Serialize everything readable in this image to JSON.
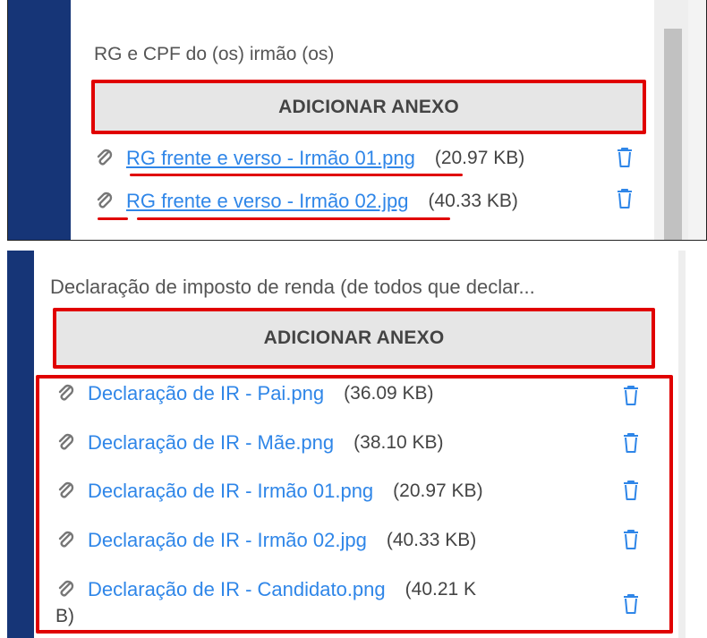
{
  "section1": {
    "label": "RG e CPF do (os) irmão (os)",
    "add_button": "ADICIONAR ANEXO",
    "files": [
      {
        "name": "RG frente e verso - Irmão 01.png",
        "size": "(20.97 KB)"
      },
      {
        "name": "RG frente e verso - Irmão 02.jpg",
        "size": "(40.33 KB)"
      }
    ]
  },
  "section2": {
    "label": "Declaração de imposto de renda (de todos que declar...",
    "add_button": "ADICIONAR ANEXO",
    "files": [
      {
        "name": "Declaração de IR - Pai.png",
        "size": "(36.09 KB)"
      },
      {
        "name": "Declaração de IR - Mãe.png",
        "size": "(38.10 KB)"
      },
      {
        "name": "Declaração de IR - Irmão 01.png",
        "size": "(20.97 KB)"
      },
      {
        "name": "Declaração de IR - Irmão 02.jpg",
        "size": "(40.33 KB)"
      },
      {
        "name": "Declaração de IR - Candidato.png",
        "size": "(40.21 K",
        "size_wrap": "B)"
      }
    ]
  },
  "icons": {
    "attachment": "paperclip-icon",
    "delete": "trash-icon"
  },
  "colors": {
    "sidebar": "#163577",
    "link": "#2f86e8",
    "highlight": "#e00000",
    "icon": "#2f86e8"
  }
}
